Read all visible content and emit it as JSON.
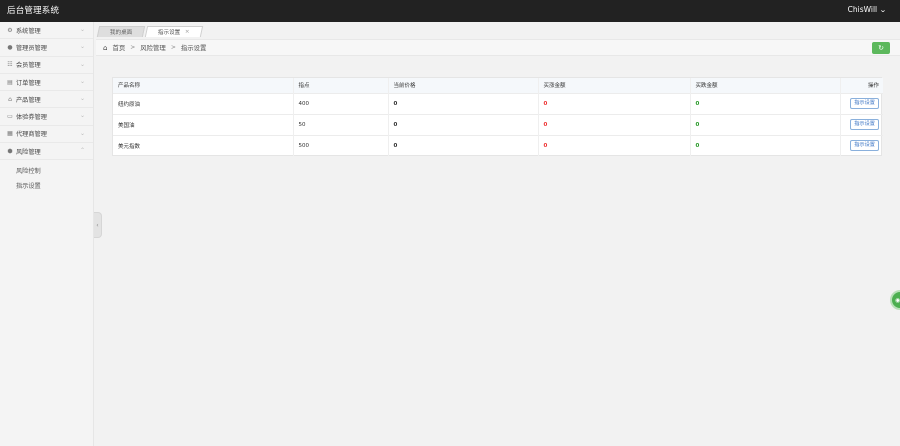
{
  "app": {
    "title": "后台管理系统",
    "user": "ChisWill"
  },
  "sidebar": {
    "items": [
      {
        "label": "系统管理",
        "icon": "gear-icon",
        "glyph": "⚙"
      },
      {
        "label": "管理员管理",
        "icon": "user-icon",
        "glyph": "👤"
      },
      {
        "label": "会员管理",
        "icon": "members-icon",
        "glyph": "☷"
      },
      {
        "label": "订单管理",
        "icon": "order-icon",
        "glyph": "▤"
      },
      {
        "label": "产品管理",
        "icon": "product-icon",
        "glyph": "⌂"
      },
      {
        "label": "体验券管理",
        "icon": "voucher-icon",
        "glyph": "▭"
      },
      {
        "label": "代理商管理",
        "icon": "agent-icon",
        "glyph": "▦"
      },
      {
        "label": "风险管理",
        "icon": "shield-icon",
        "glyph": "⬢"
      }
    ],
    "subitems": [
      {
        "label": "风险控制"
      },
      {
        "label": "指示设置"
      }
    ]
  },
  "tabs": [
    {
      "label": "我的桌面",
      "state": "inactive"
    },
    {
      "label": "指示设置",
      "state": "active",
      "close": "×"
    }
  ],
  "breadcrumb": {
    "home": "首页",
    "level1": "风险管理",
    "level2": "指示设置",
    "sep": ">"
  },
  "table": {
    "headers": [
      "产品名称",
      "指点",
      "当前价格",
      "买涨金额",
      "买跌金额",
      "操作"
    ],
    "rows": [
      {
        "name": "纽约原油",
        "point": "400",
        "price": "0",
        "up": "0",
        "down": "0",
        "action": "指示设置"
      },
      {
        "name": "美国油",
        "point": "50",
        "price": "0",
        "up": "0",
        "down": "0",
        "action": "指示设置"
      },
      {
        "name": "美元指数",
        "point": "500",
        "price": "0",
        "up": "0",
        "down": "0",
        "action": "指示设置"
      }
    ]
  },
  "colors": {
    "topbar": "#222222",
    "refresh": "#5cb85c",
    "up_amount": "#e33333",
    "down_amount": "#2a9a2a"
  }
}
